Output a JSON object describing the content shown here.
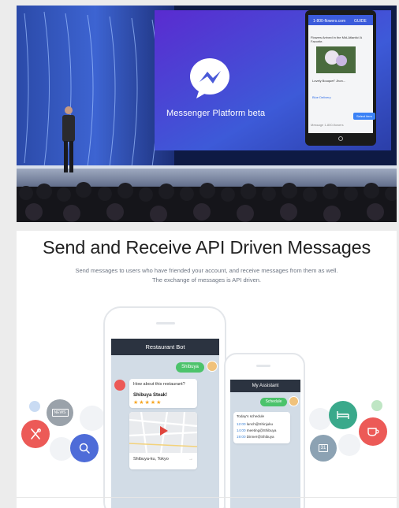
{
  "stage": {
    "screen_label": "Messenger Platform beta",
    "phone": {
      "title": "1-800-flowers.com",
      "tag": "GUIDE",
      "message": "Flowers Arrived in the Mid-Atlantic! A Favorite.",
      "caption": "Lovely Bouquet\" Jhon...",
      "link": "Blue Delivery",
      "input": "Message 1-800-flowers",
      "action": "Select item"
    }
  },
  "panel": {
    "title": "Send and Receive API Driven Messages",
    "subtitle_line1": "Send messages to users who have friended your account, and receive messages from them as well.",
    "subtitle_line2": "The exchange of messages is API driven.",
    "restaurant": {
      "header": "Restaurant Bot",
      "user_message": "Shibuya",
      "bot_question": "How about this restaurant?",
      "place_name": "Shibuya Steak!",
      "stars": "★★★★★",
      "map_caption": "Shibuya-ku, Tokyo"
    },
    "assistant": {
      "header": "My Assistant",
      "user_message": "Schedule",
      "schedule_title": "Today's schedule",
      "items": [
        {
          "time": "12:00",
          "text": "lunch@Shinjuku"
        },
        {
          "time": "14:00",
          "text": "meeting@Shibuya"
        },
        {
          "time": "19:00",
          "text": "Dinner@Shibuya"
        }
      ]
    },
    "icons": {
      "news_label": "NEWS",
      "calendar_label": "31"
    },
    "colors": {
      "accent_green": "#4cc36b",
      "header_dark": "#2b3340",
      "red": "#ec5a57",
      "blue": "#4e6cd8",
      "gray": "#9aa2aa",
      "teal": "#3aa98b",
      "slate": "#8ca2b3"
    }
  }
}
